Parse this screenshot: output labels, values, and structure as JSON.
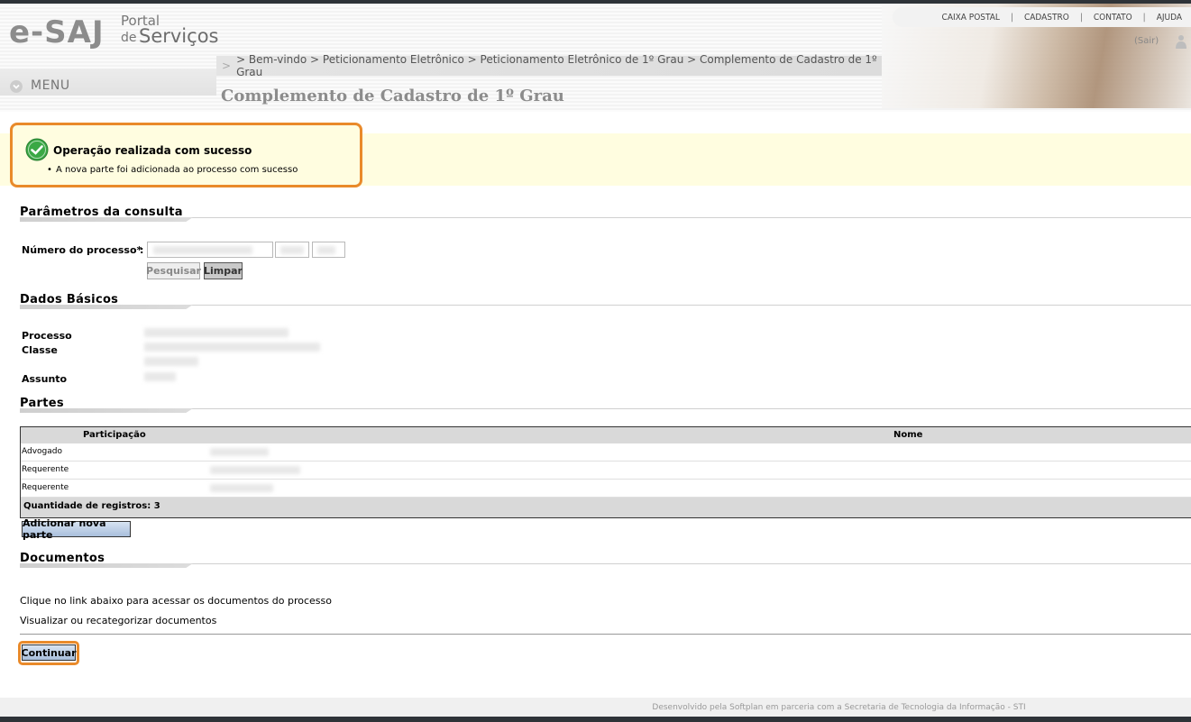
{
  "header": {
    "logo": {
      "brand": "e-SAJ",
      "portal": "Portal",
      "de": "de",
      "servicos": "Serviços"
    },
    "topnav": [
      "CAIXA POSTAL",
      "CADASTRO",
      "CONTATO",
      "AJUDA"
    ],
    "topnav_separator": "|",
    "sair": "(Sair)",
    "breadcrumb_lead": ">",
    "breadcrumb": "> Bem-vindo > Peticionamento Eletrônico > Peticionamento Eletrônico de 1º Grau > Complemento de Cadastro de 1º Grau",
    "menu_label": "MENU",
    "page_title": "Complemento de Cadastro de 1º Grau"
  },
  "message": {
    "title": "Operação realizada com sucesso",
    "item": "A nova parte foi adicionada ao processo com sucesso"
  },
  "parametros": {
    "title": "Parâmetros da consulta",
    "numero_label": "Número do processo*",
    "colon": ":",
    "pesquisar": "Pesquisar",
    "limpar": "Limpar"
  },
  "dados_basicos": {
    "title": "Dados Básicos",
    "processo_label": "Processo",
    "classe_label": "Classe",
    "assunto_label": "Assunto"
  },
  "partes": {
    "title": "Partes",
    "columns": [
      "Participação",
      "Nome"
    ],
    "rows": [
      "Advogado",
      "Requerente",
      "Requerente"
    ],
    "footer": "Quantidade de registros: 3",
    "add_button": "Adicionar nova parte"
  },
  "documentos": {
    "title": "Documentos",
    "instructions": "Clique no link abaixo para acessar os documentos do processo",
    "link": "Visualizar ou recategorizar documentos"
  },
  "continuar": "Continuar",
  "footer": "Desenvolvido pela Softplan em parceria com a Secretaria de Tecnologia da Informação - STI",
  "colors": {
    "accent_orange": "#e98a2a",
    "success_green": "#3aa845",
    "message_bg": "#fffde0"
  }
}
